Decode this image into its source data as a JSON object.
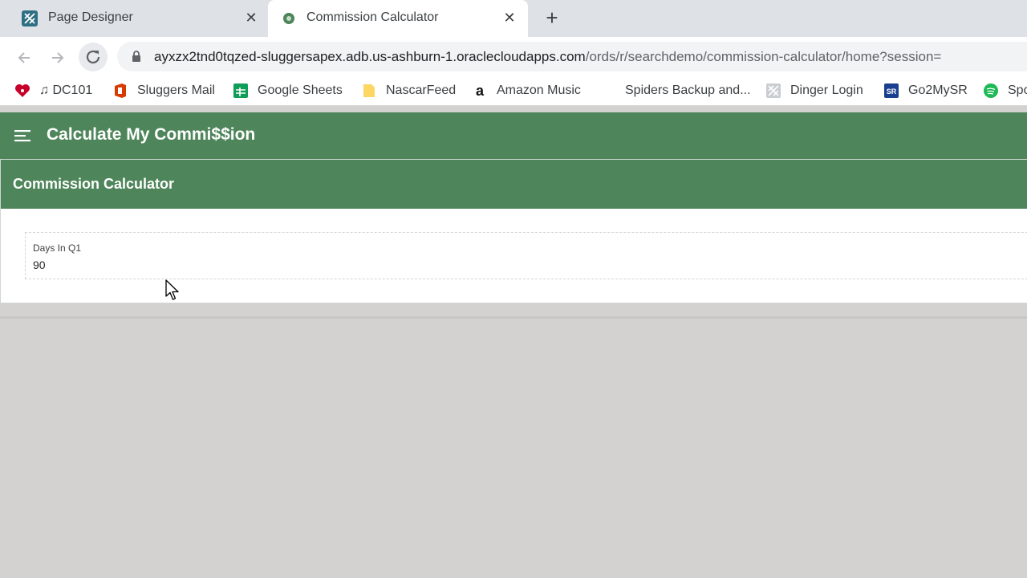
{
  "browser": {
    "tabs": [
      {
        "label": "Page Designer",
        "icon": "page-designer-icon",
        "active": false
      },
      {
        "label": "Commission Calculator",
        "icon": "apex-app-icon",
        "active": true
      }
    ],
    "url_host": "ayxzx2tnd0tqzed-sluggersapex.adb.us-ashburn-1.oraclecloudapps.com",
    "url_path": "/ords/r/searchdemo/commission-calculator/home?session=",
    "bookmarks": [
      {
        "label": "♫ DC101",
        "icon": "iheart-icon"
      },
      {
        "label": "Sluggers Mail",
        "icon": "office-icon"
      },
      {
        "label": "Google Sheets",
        "icon": "google-sheets-icon"
      },
      {
        "label": "NascarFeed",
        "icon": "folder-icon"
      },
      {
        "label": "Amazon Music",
        "icon": "amazon-icon"
      },
      {
        "label": "Spiders Backup and...",
        "icon": ""
      },
      {
        "label": "Dinger Login",
        "icon": "dinger-icon"
      },
      {
        "label": "Go2MySR",
        "icon": "sr-icon"
      },
      {
        "label": "Spo",
        "icon": "spotify-icon"
      }
    ]
  },
  "app": {
    "title": "Calculate My Commi$$ion",
    "region_title": "Commission Calculator",
    "field_label": "Days In Q1",
    "field_value": "90"
  },
  "colors": {
    "header_green": "#4e855a",
    "page_bg": "#d3d2d1"
  }
}
